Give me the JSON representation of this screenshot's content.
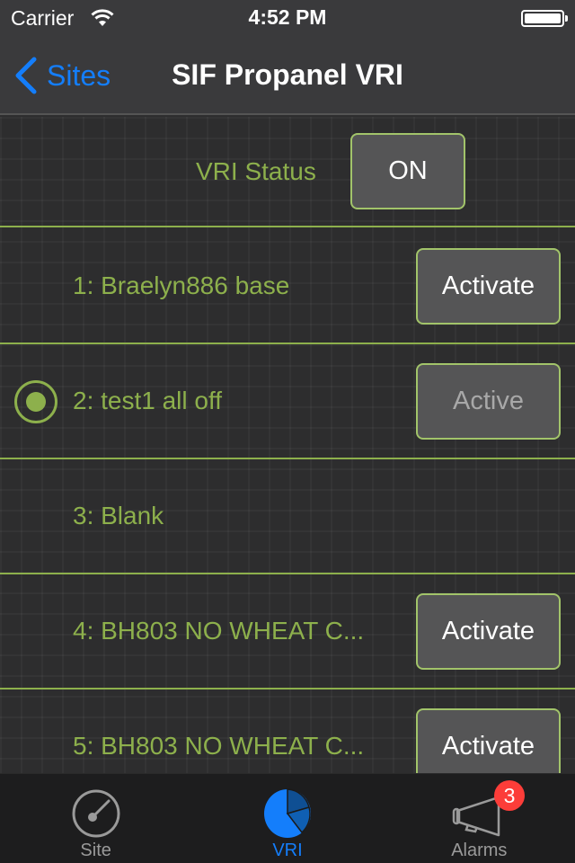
{
  "status_bar": {
    "carrier": "Carrier",
    "time": "4:52 PM",
    "wifi_icon": "wifi-icon",
    "battery_icon": "battery-full-icon"
  },
  "nav": {
    "back_label": "Sites",
    "back_icon": "chevron-left-icon",
    "title": "SIF Propanel VRI"
  },
  "vri_status": {
    "label": "VRI Status",
    "button_label": "ON"
  },
  "prescriptions": [
    {
      "name": "1: Braelyn886 base",
      "button_label": "Activate",
      "selected": false
    },
    {
      "name": "2: test1 all off",
      "button_label": "Active",
      "selected": true
    },
    {
      "name": "3: Blank",
      "button_label": null,
      "selected": false
    },
    {
      "name": "4: BH803 NO WHEAT C...",
      "button_label": "Activate",
      "selected": false
    },
    {
      "name": "5: BH803 NO WHEAT C...",
      "button_label": "Activate",
      "selected": false
    }
  ],
  "tabs": [
    {
      "label": "Site",
      "icon": "gauge-icon",
      "selected": false
    },
    {
      "label": "VRI",
      "icon": "pie-chart-icon",
      "selected": true
    },
    {
      "label": "Alarms",
      "icon": "megaphone-icon",
      "selected": false,
      "badge": "3"
    }
  ],
  "colors": {
    "accent_green": "#8db04c",
    "ios_blue": "#147efb",
    "badge_red": "#fc3d39",
    "button_bg": "#555556"
  }
}
